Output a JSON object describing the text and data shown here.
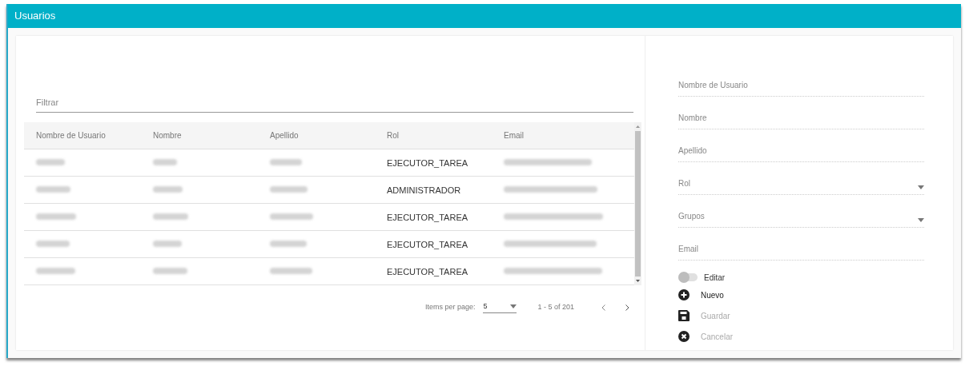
{
  "header": {
    "title": "Usuarios"
  },
  "filter": {
    "placeholder": "Filtrar"
  },
  "table": {
    "columns": [
      "Nombre de Usuario",
      "Nombre",
      "Apellido",
      "Rol",
      "Email"
    ],
    "rows": [
      {
        "cells": [
          {
            "kind": "redacted"
          },
          {
            "kind": "redacted"
          },
          {
            "kind": "redacted"
          },
          {
            "kind": "text",
            "text": "EJECUTOR_TAREA"
          },
          {
            "kind": "redacted"
          }
        ]
      },
      {
        "cells": [
          {
            "kind": "redacted"
          },
          {
            "kind": "redacted"
          },
          {
            "kind": "redacted"
          },
          {
            "kind": "text",
            "text": "ADMINISTRADOR"
          },
          {
            "kind": "redacted"
          }
        ]
      },
      {
        "cells": [
          {
            "kind": "redacted"
          },
          {
            "kind": "redacted"
          },
          {
            "kind": "redacted"
          },
          {
            "kind": "text",
            "text": "EJECUTOR_TAREA"
          },
          {
            "kind": "redacted"
          }
        ]
      },
      {
        "cells": [
          {
            "kind": "redacted"
          },
          {
            "kind": "redacted"
          },
          {
            "kind": "redacted"
          },
          {
            "kind": "text",
            "text": "EJECUTOR_TAREA"
          },
          {
            "kind": "redacted"
          }
        ]
      },
      {
        "cells": [
          {
            "kind": "redacted"
          },
          {
            "kind": "redacted"
          },
          {
            "kind": "redacted"
          },
          {
            "kind": "text",
            "text": "EJECUTOR_TAREA"
          },
          {
            "kind": "redacted"
          }
        ]
      }
    ]
  },
  "paginator": {
    "label": "Items per page:",
    "page_size": "5",
    "range": "1 - 5 of 201"
  },
  "form": {
    "fields": [
      {
        "kind": "input",
        "placeholder": "Nombre de Usuario"
      },
      {
        "kind": "input",
        "placeholder": "Nombre"
      },
      {
        "kind": "input",
        "placeholder": "Apellido"
      },
      {
        "kind": "select",
        "placeholder": "Rol"
      },
      {
        "kind": "select",
        "placeholder": "Grupos"
      },
      {
        "kind": "input",
        "placeholder": "Email"
      }
    ],
    "toggle": {
      "label": "Editar",
      "on": false
    },
    "actions": [
      {
        "kind": "new",
        "label": "Nuevo",
        "disabled": false
      },
      {
        "kind": "save",
        "label": "Guardar",
        "disabled": true
      },
      {
        "kind": "cancel",
        "label": "Cancelar",
        "disabled": true
      }
    ]
  }
}
